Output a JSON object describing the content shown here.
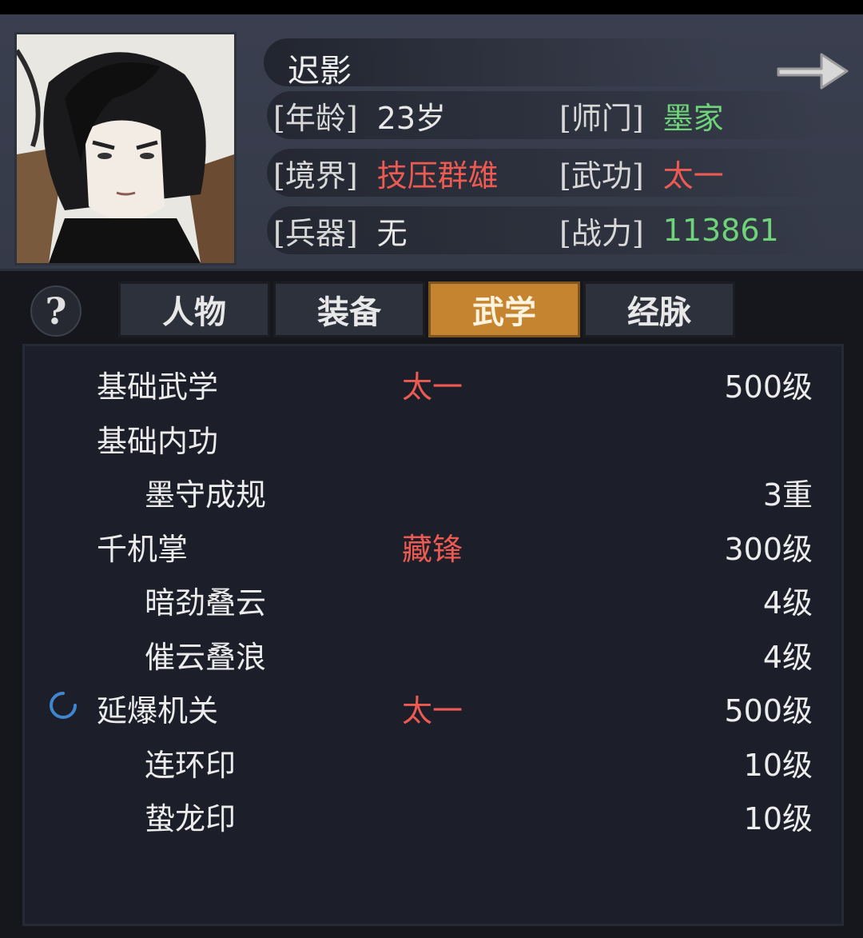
{
  "character": {
    "name": "迟影",
    "stats": {
      "age": {
        "label": "[年龄]",
        "value": "23岁"
      },
      "sect": {
        "label": "[师门]",
        "value": "墨家"
      },
      "realm": {
        "label": "[境界]",
        "value": "技压群雄"
      },
      "martial": {
        "label": "[武功]",
        "value": "太一"
      },
      "weapon": {
        "label": "[兵器]",
        "value": "无"
      },
      "power": {
        "label": "[战力]",
        "value": "113861"
      }
    }
  },
  "help_label": "?",
  "tabs": [
    {
      "label": "人物",
      "active": false
    },
    {
      "label": "装备",
      "active": false
    },
    {
      "label": "武学",
      "active": true
    },
    {
      "label": "经脉",
      "active": false
    }
  ],
  "skills": [
    {
      "name": "基础武学",
      "tag": "太一",
      "level": "500级"
    },
    {
      "name": "基础内功",
      "tag": "",
      "level": ""
    },
    {
      "name": "墨守成规",
      "tag": "",
      "level": "3重"
    },
    {
      "name": "千机掌",
      "tag": "藏锋",
      "level": "300级"
    },
    {
      "name": "暗劲叠云",
      "tag": "",
      "level": "4级"
    },
    {
      "name": "催云叠浪",
      "tag": "",
      "level": "4级"
    },
    {
      "name": "延爆机关",
      "tag": "太一",
      "level": "500级"
    },
    {
      "name": "连环印",
      "tag": "",
      "level": "10级"
    },
    {
      "name": "蛰龙印",
      "tag": "",
      "level": "10级"
    }
  ],
  "colors": {
    "accent_tab": "#c5842f",
    "red_text": "#ec5a52",
    "green_text": "#6fd37a",
    "panel_bg": "#1c1f29",
    "header_bg": "#3a3f4f"
  },
  "icons": {
    "next": "arrow-right-icon",
    "help": "question-icon",
    "active_skill": "loading-spinner-icon"
  }
}
